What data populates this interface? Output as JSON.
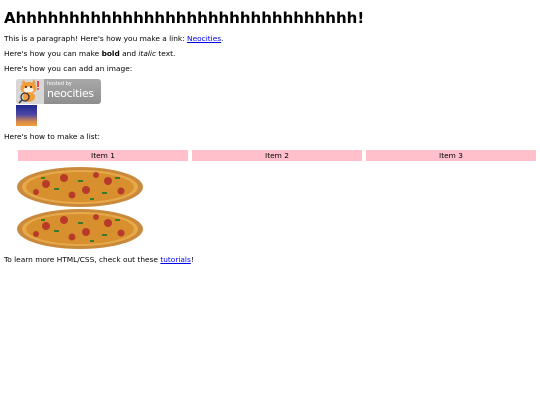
{
  "heading": "Ahhhhhhhhhhhhhhhhhhhhhhhhhhhhhhhh!",
  "intro": {
    "text": "This is a paragraph! Here's how you make a link: ",
    "link": "Neocities",
    "end": "."
  },
  "formatting": {
    "prefix": "Here's how you can make ",
    "bold": "bold",
    "middle": " and ",
    "italic": "italic",
    "suffix": " text."
  },
  "image_intro": "Here's how you can add an image:",
  "badge": {
    "hosted_by": "hosted by",
    "brand": "neocities"
  },
  "list_intro": "Here's how to make a list:",
  "list_items": [
    "Item 1",
    "Item 2",
    "Item 3"
  ],
  "learn": {
    "text": "To learn more HTML/CSS, check out these ",
    "link": "tutorials",
    "end": "!"
  },
  "colors": {
    "list_cell_bg": "#ffc0cb",
    "link": "#0000ee"
  }
}
